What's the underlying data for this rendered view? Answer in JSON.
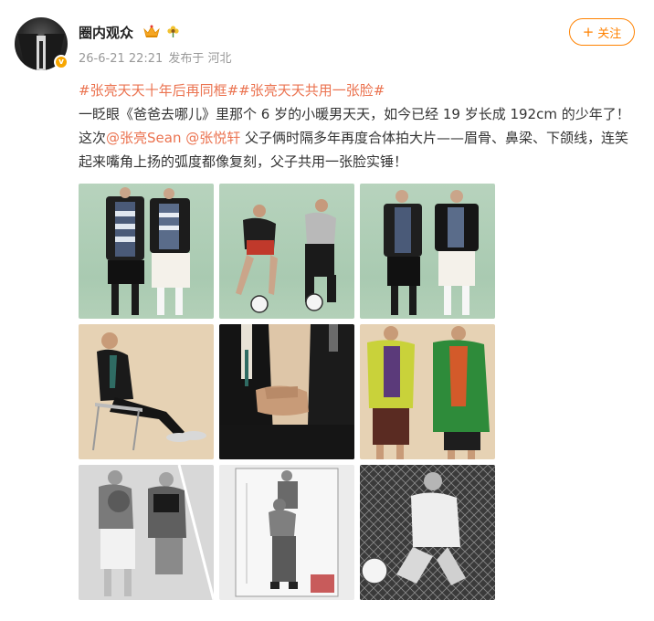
{
  "post": {
    "username": "圈内观众",
    "verified_badge": "v",
    "timestamp": "26-6-21 22:21",
    "location": "发布于 河北",
    "follow_label": "关注",
    "follow_plus": "+",
    "hashtags": [
      "#张亮天天十年后再同框#",
      "#张亮天天共用一张脸#"
    ],
    "text_1": "一眨眼《爸爸去哪儿》里那个 6 岁的小暖男天天，如今已经 19 岁长成 192cm 的少年了！这次",
    "mention_1": "@张亮Sean",
    "mention_2": "@张悦轩",
    "text_2": " 父子俩时隔多年再度合体拍大片——眉骨、鼻梁、下颌线，连笑起来嘴角上扬的弧度都像复刻，父子共用一张脸实锤！"
  },
  "icons": {
    "avatar": "avatar-suit",
    "crown": "crown-icon",
    "flower": "flower-icon"
  },
  "colors": {
    "accent_orange": "#ff8200",
    "link": "#eb7350",
    "verified": "#f7a600"
  }
}
